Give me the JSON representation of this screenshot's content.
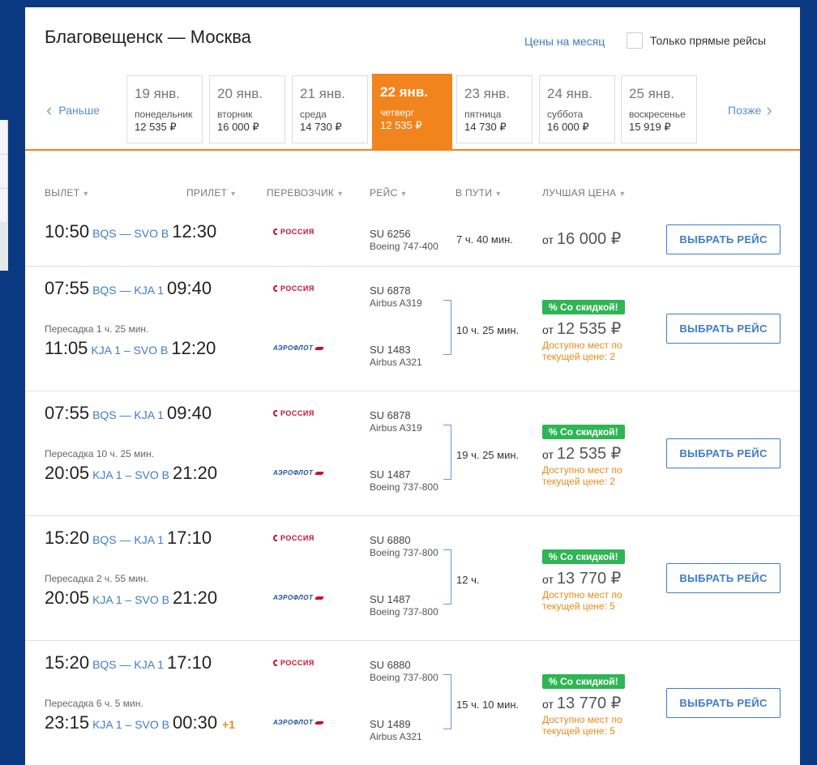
{
  "header": {
    "route": "Благовещенск — Москва",
    "month_prices_link": "Цены на месяц",
    "direct_only_label": "Только прямые рейсы"
  },
  "date_nav": {
    "prev_label": "Раньше",
    "next_label": "Позже",
    "dates": [
      {
        "day": "19 янв.",
        "weekday": "понедельник",
        "price": "12 535 ₽",
        "active": false
      },
      {
        "day": "20 янв.",
        "weekday": "вторник",
        "price": "16 000 ₽",
        "active": false
      },
      {
        "day": "21 янв.",
        "weekday": "среда",
        "price": "14 730 ₽",
        "active": false
      },
      {
        "day": "22 янв.",
        "weekday": "четверг",
        "price": "12 535 ₽",
        "active": true
      },
      {
        "day": "23 янв.",
        "weekday": "пятница",
        "price": "14 730 ₽",
        "active": false
      },
      {
        "day": "24 янв.",
        "weekday": "суббота",
        "price": "16 000 ₽",
        "active": false
      },
      {
        "day": "25 янв.",
        "weekday": "воскресенье",
        "price": "15 919 ₽",
        "active": false
      }
    ]
  },
  "columns": {
    "departure": "ВЫЛЕТ",
    "arrival": "ПРИЛЕТ",
    "carrier": "ПЕРЕВОЗЧИК",
    "flight": "РЕЙС",
    "duration": "В ПУТИ",
    "best_price": "ЛУЧШАЯ ЦЕНА"
  },
  "airlines": {
    "rossiya": "РОССИЯ",
    "aeroflot": "АЭРОФЛОТ"
  },
  "select_button_label": "ВЫБРАТЬ РЕЙС",
  "discount_badge": "% Со скидкой!",
  "price_prefix": "от",
  "results": [
    {
      "duration": "7 ч. 40 мин.",
      "price": "16 000 ₽",
      "discount": false,
      "availability": "",
      "transfer": "",
      "segments": [
        {
          "dep": "10:50",
          "route": "BQS — SVO B",
          "arr": "12:30",
          "plus": "",
          "flight": "SU 6256",
          "aircraft": "Boeing 747-400",
          "airline": "rossiya"
        }
      ]
    },
    {
      "duration": "10 ч. 25 мин.",
      "price": "12 535 ₽",
      "discount": true,
      "availability": "Доступно мест по текущей цене: 2",
      "transfer": "Пересадка 1 ч. 25 мин.",
      "segments": [
        {
          "dep": "07:55",
          "route": "BQS — KJA 1",
          "arr": "09:40",
          "plus": "",
          "flight": "SU 6878",
          "aircraft": "Airbus A319",
          "airline": "rossiya"
        },
        {
          "dep": "11:05",
          "route": "KJA 1 – SVO B",
          "arr": "12:20",
          "plus": "",
          "flight": "SU 1483",
          "aircraft": "Airbus A321",
          "airline": "aeroflot"
        }
      ]
    },
    {
      "duration": "19 ч. 25 мин.",
      "price": "12 535 ₽",
      "discount": true,
      "availability": "Доступно мест по текущей цене: 2",
      "transfer": "Пересадка 10 ч. 25 мин.",
      "segments": [
        {
          "dep": "07:55",
          "route": "BQS — KJA 1",
          "arr": "09:40",
          "plus": "",
          "flight": "SU 6878",
          "aircraft": "Airbus A319",
          "airline": "rossiya"
        },
        {
          "dep": "20:05",
          "route": "KJA 1 – SVO B",
          "arr": "21:20",
          "plus": "",
          "flight": "SU 1487",
          "aircraft": "Boeing 737-800",
          "airline": "aeroflot"
        }
      ]
    },
    {
      "duration": "12 ч.",
      "price": "13 770 ₽",
      "discount": true,
      "availability": "Доступно мест по текущей цене: 5",
      "transfer": "Пересадка 2 ч. 55 мин.",
      "segments": [
        {
          "dep": "15:20",
          "route": "BQS — KJA 1",
          "arr": "17:10",
          "plus": "",
          "flight": "SU 6880",
          "aircraft": "Boeing 737-800",
          "airline": "rossiya"
        },
        {
          "dep": "20:05",
          "route": "KJA 1 – SVO B",
          "arr": "21:20",
          "plus": "",
          "flight": "SU 1487",
          "aircraft": "Boeing 737-800",
          "airline": "aeroflot"
        }
      ]
    },
    {
      "duration": "15 ч. 10 мин.",
      "price": "13 770 ₽",
      "discount": true,
      "availability": "Доступно мест по текущей цене: 5",
      "transfer": "Пересадка 6 ч. 5 мин.",
      "segments": [
        {
          "dep": "15:20",
          "route": "BQS — KJA 1",
          "arr": "17:10",
          "plus": "",
          "flight": "SU 6880",
          "aircraft": "Boeing 737-800",
          "airline": "rossiya"
        },
        {
          "dep": "23:15",
          "route": "KJA 1 – SVO B",
          "arr": "00:30",
          "plus": "+1",
          "flight": "SU 1489",
          "aircraft": "Airbus A321",
          "airline": "aeroflot"
        }
      ]
    }
  ]
}
